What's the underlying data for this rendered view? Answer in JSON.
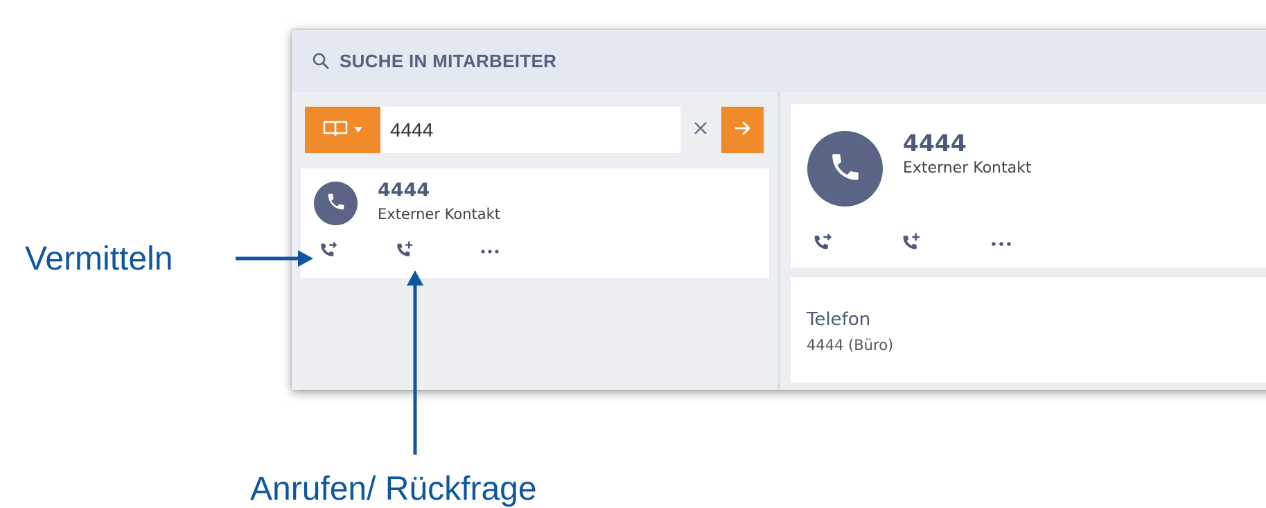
{
  "search": {
    "title": "SUCHE IN MITARBEITER",
    "query": "4444",
    "icon": "search-icon"
  },
  "result": {
    "number": "4444",
    "type": "Externer Kontakt",
    "actions": [
      "transfer-call-icon",
      "add-call-icon",
      "more-icon"
    ]
  },
  "detail": {
    "number": "4444",
    "type": "Externer Kontakt",
    "phone_label": "Telefon",
    "phone_value": "4444  (Büro)"
  },
  "callouts": {
    "transfer": "Vermitteln",
    "consult": "Anrufen/ Rückfrage"
  },
  "colors": {
    "accent": "#f08a2b",
    "avatar": "#5a6485",
    "text_primary": "#4f5a7a",
    "callout": "#0f56a0"
  }
}
